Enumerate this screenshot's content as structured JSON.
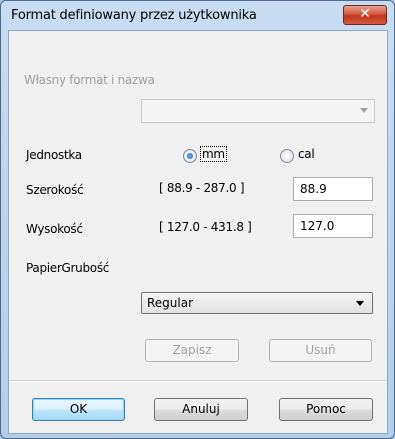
{
  "window": {
    "title": "Format definiowany przez użytkownika",
    "close_glyph": "✕"
  },
  "name_group": {
    "label": "Własny format i nazwa",
    "value": ""
  },
  "unit": {
    "label": "Jednostka",
    "options": [
      {
        "label": "mm",
        "selected": true
      },
      {
        "label": "cal",
        "selected": false
      }
    ]
  },
  "width": {
    "label": "Szerokość",
    "range": "[ 88.9 - 287.0 ]",
    "value": "88.9"
  },
  "height": {
    "label": "Wysokość",
    "range": "[ 127.0 - 431.8 ]",
    "value": "127.0"
  },
  "paper_thickness": {
    "label": "PapierGrubość",
    "selected": "Regular"
  },
  "buttons": {
    "save": "Zapisz",
    "delete": "Usuń",
    "ok": "OK",
    "cancel": "Anuluj",
    "help": "Pomoc"
  },
  "colors": {
    "frame": "#b3cde9",
    "close_button": "#c0361c",
    "default_button_border": "#3c7fb1"
  }
}
